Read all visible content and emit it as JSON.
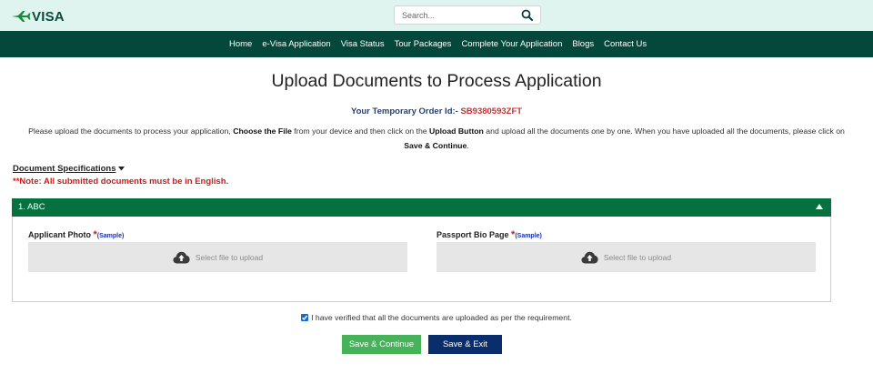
{
  "logo": {
    "text": "VISA"
  },
  "search": {
    "placeholder": "Search..."
  },
  "nav": {
    "items": [
      "Home",
      "e-Visa Application",
      "Visa Status",
      "Tour Packages",
      "Complete Your Application",
      "Blogs",
      "Contact Us"
    ]
  },
  "page": {
    "title": "Upload Documents to Process Application",
    "order_label": "Your Temporary Order Id:- ",
    "order_id": "SB9380593ZFT",
    "instructions": {
      "part1": "Please upload the documents to process your application, ",
      "choose": "Choose the File",
      "part2": " from your device and then click on the ",
      "upload": "Upload Button",
      "part3": " and upload all the documents one by one. When you have uploaded all the documents, please click on ",
      "save": "Save & Continue",
      "part4": "."
    },
    "spec_label": "Document Specifications",
    "note": "**Note: All submitted documents must be in English."
  },
  "panel": {
    "title": "1. ABC",
    "fields": [
      {
        "label": "Applicant Photo ",
        "required": "*",
        "sample": "(Sample)",
        "upload_text": "Select file to upload"
      },
      {
        "label": "Passport Bio Page ",
        "required": "*",
        "sample": "(Sample)",
        "upload_text": "Select file to upload"
      }
    ]
  },
  "verify": {
    "text": "I have verified that all the documents are uploaded as per the requirement.",
    "checked": true
  },
  "buttons": {
    "save_continue": "Save & Continue",
    "save_exit": "Save & Exit"
  },
  "colors": {
    "topbar": "#dff4ef",
    "navbar": "#04473b",
    "panel_header": "#05713f",
    "continue_button": "#47b25a",
    "exit_button": "#0a2e6b",
    "order_id": "#d0302f",
    "note": "#cc1b1b"
  }
}
